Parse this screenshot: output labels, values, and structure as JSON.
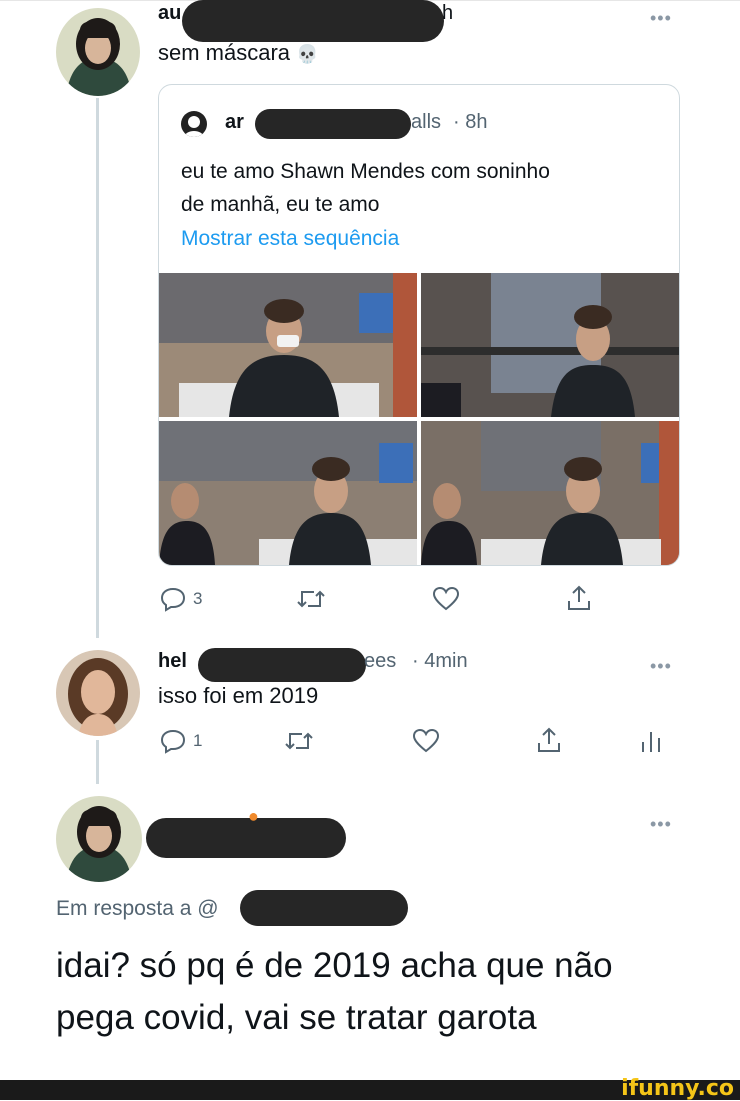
{
  "tweet1": {
    "name_fragment_left": "au",
    "name_fragment_right": "h",
    "text": "sem máscara",
    "emoji": "💀",
    "quoted": {
      "name_fragment_left": "ar",
      "name_fragment_right": "alls",
      "time": "· 8h",
      "text_line1": "eu te amo Shawn Mendes com soninho",
      "text_line2": "de manhã, eu te amo",
      "show_thread": "Mostrar esta sequência"
    },
    "actions": {
      "reply_count": "3"
    }
  },
  "tweet2": {
    "name_fragment_left": "hel",
    "name_fragment_right": "ees",
    "time": "· 4min",
    "text": "isso foi em 2019",
    "actions": {
      "reply_count": "1"
    }
  },
  "tweet3": {
    "reply_to_label": "Em resposta a",
    "reply_to_fragment": "@",
    "text_line1": "idai? só pq é de 2019 acha que não",
    "text_line2": "pega covid, vai se tratar garota"
  },
  "watermark": "ifunny.co",
  "colors": {
    "link": "#1d9bf0",
    "muted": "#536471",
    "line": "#cfd9de",
    "redaction": "#262626",
    "watermark": "#f5c518"
  }
}
